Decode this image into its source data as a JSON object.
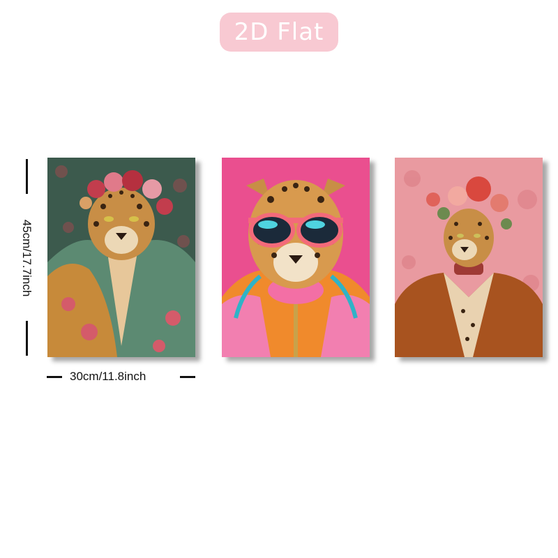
{
  "badge": {
    "label": "2D Flat",
    "color": "#f8c9d2"
  },
  "dimensions": {
    "height_label": "45cm/17.7inch",
    "width_label": "30cm/11.8inch"
  },
  "panels": [
    {
      "id": "panel-1",
      "background": "#3e5a4e"
    },
    {
      "id": "panel-2",
      "background": "#ea4f8f"
    },
    {
      "id": "panel-3",
      "background": "#e99aa0"
    }
  ]
}
